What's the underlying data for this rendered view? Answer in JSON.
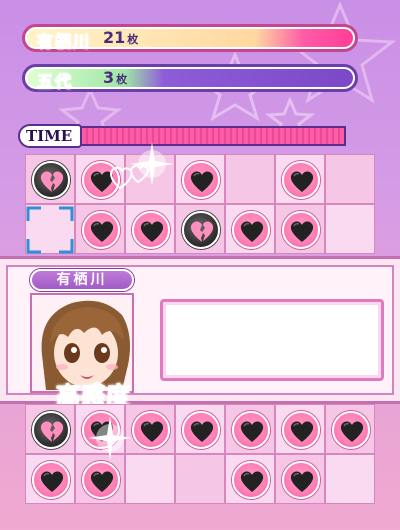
{
  "players": [
    {
      "name": "有栖川",
      "count": "21",
      "unit": "枚",
      "bar_fraction": 1.0,
      "color": "#ff5aa8"
    },
    {
      "name": "五代",
      "count": "3",
      "unit": "枚",
      "bar_fraction": 1.0,
      "color": "#8b55d8"
    }
  ],
  "timer": {
    "label": "TIME"
  },
  "board_top": {
    "rows": [
      [
        "broken",
        "heart",
        "empty",
        "heart",
        "empty",
        "heart",
        "empty"
      ],
      [
        "empty",
        "heart",
        "heart",
        "broken",
        "heart",
        "heart",
        "empty"
      ]
    ]
  },
  "board_bottom": {
    "rows": [
      [
        "broken",
        "heart",
        "heart",
        "heart",
        "heart",
        "heart",
        "heart"
      ],
      [
        "heart",
        "heart",
        "empty",
        "empty",
        "heart",
        "heart",
        "empty"
      ]
    ]
  },
  "dialog": {
    "speaker": "有栖川",
    "stat_label": "高感度",
    "message": ""
  },
  "colors": {
    "accent": "#ff5aa8",
    "rival": "#8b55d8",
    "panel_border": "#c66fb0"
  }
}
